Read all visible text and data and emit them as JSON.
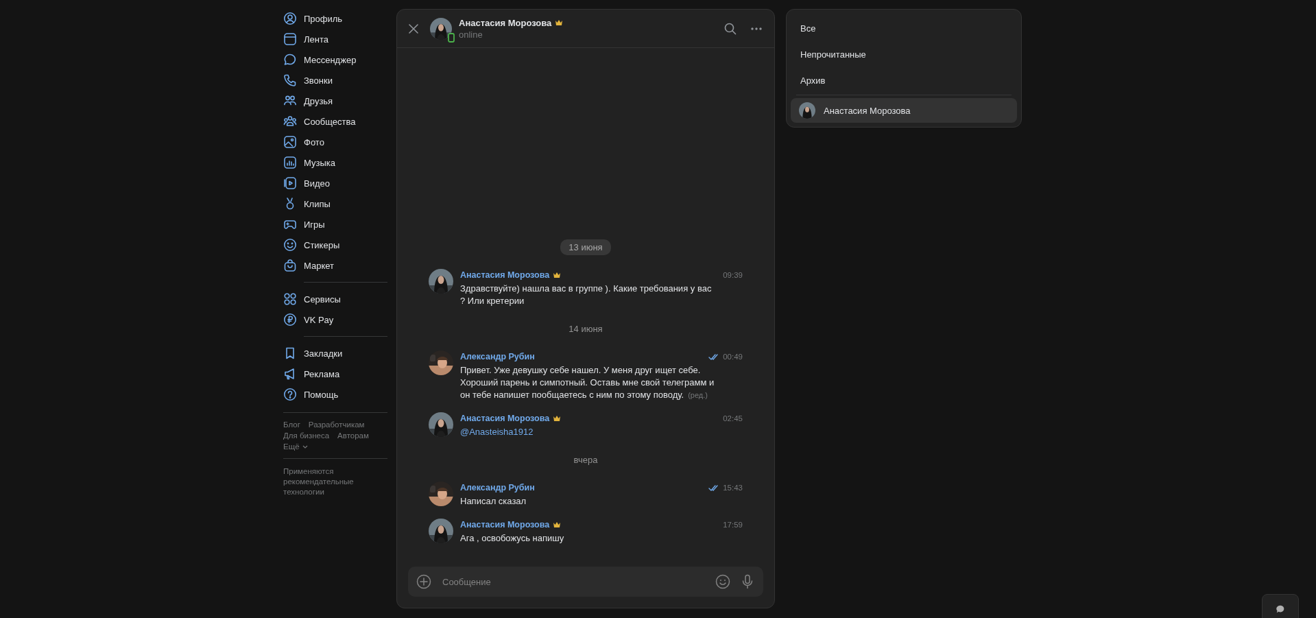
{
  "sidebar": {
    "groups": [
      {
        "items": [
          {
            "label": "Профиль"
          },
          {
            "label": "Лента"
          },
          {
            "label": "Мессенджер"
          },
          {
            "label": "Звонки"
          },
          {
            "label": "Друзья"
          },
          {
            "label": "Сообщества"
          },
          {
            "label": "Фото"
          },
          {
            "label": "Музыка"
          },
          {
            "label": "Видео"
          },
          {
            "label": "Клипы"
          },
          {
            "label": "Игры"
          },
          {
            "label": "Стикеры"
          },
          {
            "label": "Маркет"
          }
        ]
      },
      {
        "items": [
          {
            "label": "Сервисы"
          },
          {
            "label": "VK Pay"
          }
        ]
      },
      {
        "items": [
          {
            "label": "Закладки"
          },
          {
            "label": "Реклама"
          },
          {
            "label": "Помощь"
          }
        ]
      }
    ],
    "footer_links": [
      "Блог",
      "Разработчикам",
      "Для бизнеса",
      "Авторам"
    ],
    "more_link": "Ещё",
    "note": "Применяются рекомендательные технологии"
  },
  "chat": {
    "header": {
      "name": "Анастасия Морозова",
      "crown": true,
      "status": "online",
      "online_mobile": true
    },
    "messages": [
      {
        "kind": "date",
        "text": "13 июня",
        "floating": true
      },
      {
        "kind": "message",
        "author": "Анастасия Морозова",
        "crown": true,
        "time": "09:39",
        "read": false,
        "text": "Здравствуйте) нашла вас в группе ). Какие требования у вас ? Или кретерии"
      },
      {
        "kind": "date",
        "text": "14 июня",
        "floating": false
      },
      {
        "kind": "message",
        "author": "Александр Рубин",
        "crown": false,
        "time": "00:49",
        "read": true,
        "text": "Привет. Уже девушку себе нашел. У меня друг ищет себе. Хороший парень и симпотный. Оставь мне свой телеграмм и он тебе напишет пообщаетесь с ним по этому поводу.",
        "edited_label": "(ред.)"
      },
      {
        "kind": "message",
        "author": "Анастасия Морозова",
        "crown": true,
        "time": "02:45",
        "read": false,
        "link": "@Anasteisha1912"
      },
      {
        "kind": "date",
        "text": "вчера",
        "floating": false
      },
      {
        "kind": "message",
        "author": "Александр Рубин",
        "crown": false,
        "time": "15:43",
        "read": true,
        "text": "Написал сказал"
      },
      {
        "kind": "message",
        "author": "Анастасия Морозова",
        "crown": true,
        "time": "17:59",
        "read": false,
        "text": "Ага , освобожусь напишу"
      }
    ],
    "composer": {
      "placeholder": "Сообщение"
    }
  },
  "filters": {
    "items": [
      {
        "label": "Все"
      },
      {
        "label": "Непрочитанные"
      },
      {
        "label": "Архив"
      }
    ],
    "chats": [
      {
        "name": "Анастасия Морозова",
        "selected": true
      }
    ]
  }
}
